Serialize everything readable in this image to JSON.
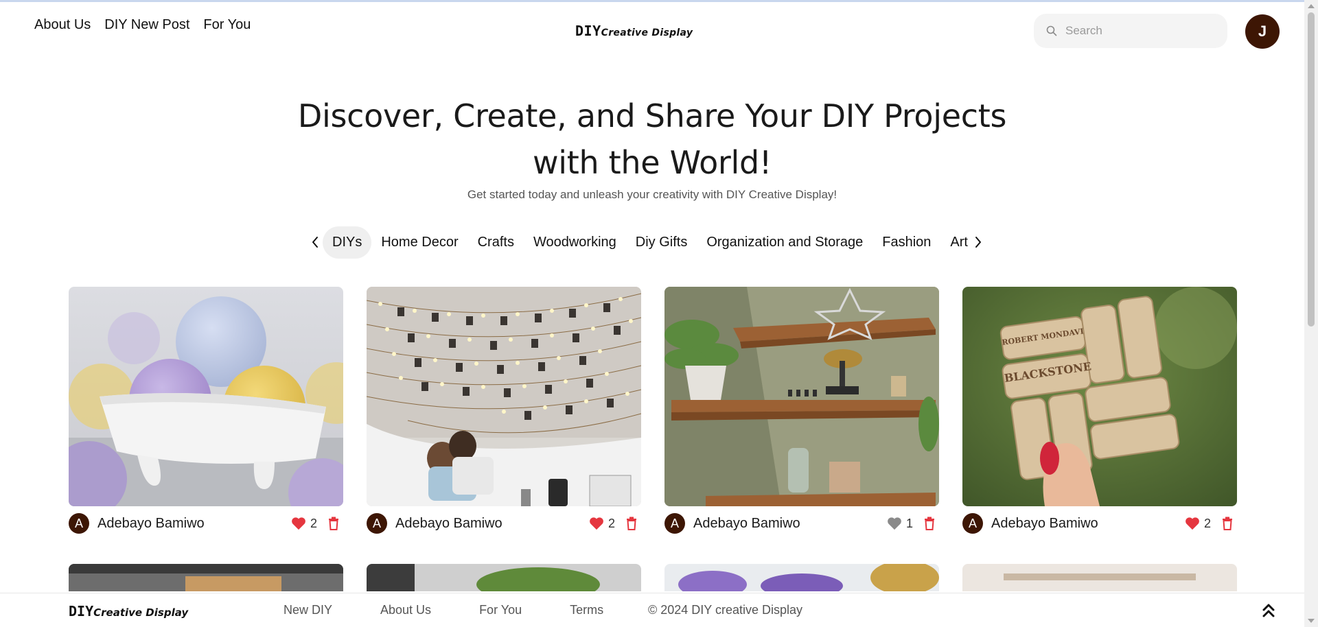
{
  "header": {
    "nav": [
      "About Us",
      "DIY New Post",
      "For You"
    ],
    "logo_main": "DIY",
    "logo_sub": "Creative Display",
    "search_placeholder": "Search",
    "user_initial": "J"
  },
  "hero": {
    "title_line1": "Discover, Create, and Share Your DIY Projects",
    "title_line2": "with the World!",
    "subtitle": "Get started today and unleash your creativity with DIY Creative Display!"
  },
  "categories": [
    "DIYs",
    "Home Decor",
    "Crafts",
    "Woodworking",
    "Diy Gifts",
    "Organization and Storage",
    "Fashion",
    "Art"
  ],
  "active_category": "DIYs",
  "cards": [
    {
      "author_initial": "A",
      "author": "Adebayo Bamiwo",
      "likes": "2",
      "liked": true,
      "image": "bath-bombs-photo"
    },
    {
      "author_initial": "A",
      "author": "Adebayo Bamiwo",
      "likes": "2",
      "liked": true,
      "image": "string-lights-photo"
    },
    {
      "author_initial": "A",
      "author": "Adebayo Bamiwo",
      "likes": "1",
      "liked": false,
      "image": "floating-shelves-photo"
    },
    {
      "author_initial": "A",
      "author": "Adebayo Bamiwo",
      "likes": "2",
      "liked": true,
      "image": "wine-corks-photo"
    }
  ],
  "footer": {
    "logo_main": "DIY",
    "logo_sub": "Creative Display",
    "links": [
      "New DIY",
      "About Us",
      "For You",
      "Terms"
    ],
    "copyright": "© 2024 DIY creative Display"
  },
  "colors": {
    "avatar": "#3d1604",
    "heart_liked": "#e5363f",
    "heart_unliked": "#8a8a8a",
    "trash": "#e5363f"
  }
}
